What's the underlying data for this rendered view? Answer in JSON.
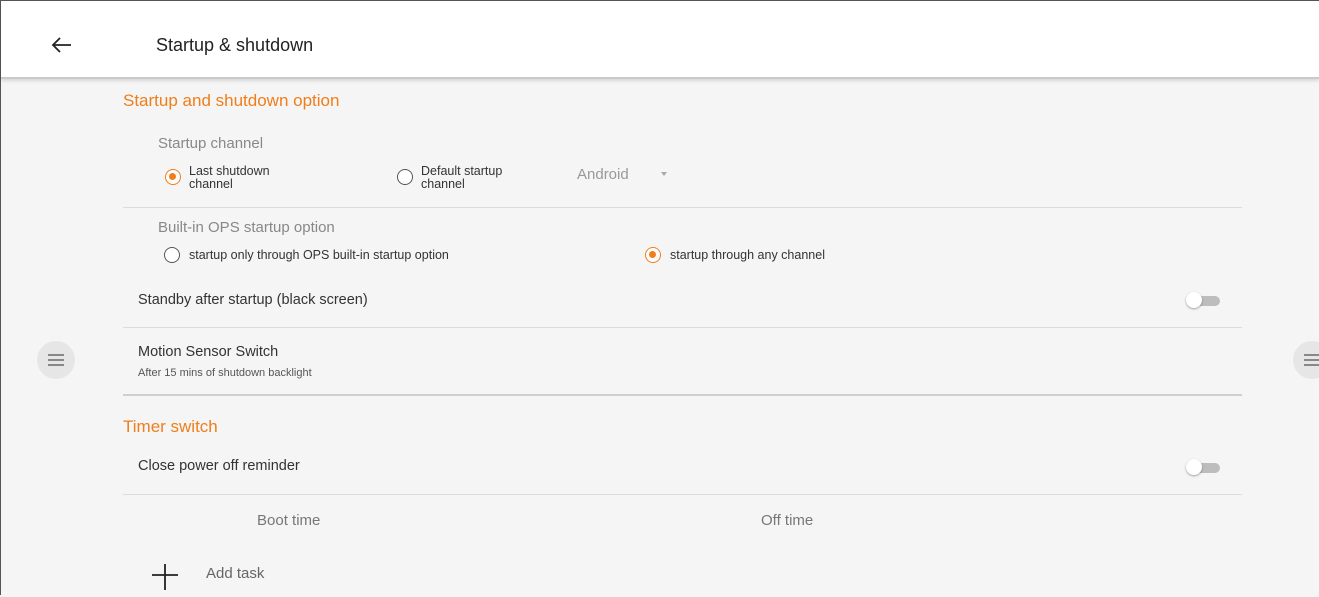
{
  "header": {
    "back_icon": "arrow-left-icon",
    "title": "Startup & shutdown"
  },
  "startup_section": {
    "title": "Startup and shutdown option",
    "startup_channel": {
      "label": "Startup channel",
      "options": [
        {
          "line1": "Last shutdown",
          "line2": "channel",
          "checked": true
        },
        {
          "line1": "Default startup",
          "line2": "channel",
          "checked": false
        }
      ],
      "dropdown_value": "Android"
    },
    "ops_option": {
      "label": "Built-in OPS startup option",
      "options": [
        {
          "label": "startup only through OPS built-in startup option",
          "checked": false
        },
        {
          "label": "startup through any channel",
          "checked": true
        }
      ]
    },
    "standby": {
      "label": "Standby after startup (black screen)",
      "enabled": false
    },
    "motion_sensor": {
      "label": "Motion Sensor Switch",
      "sublabel": "After 15 mins of shutdown backlight"
    }
  },
  "timer_section": {
    "title": "Timer switch",
    "power_off_reminder": {
      "label": "Close power off reminder",
      "enabled": false
    },
    "columns": [
      "Boot time",
      "Off time"
    ],
    "add_task_label": "Add task",
    "add_icon": "plus-icon"
  },
  "colors": {
    "accent": "#ef7e1b",
    "background": "#f5f5f5",
    "header_bg": "#ffffff"
  }
}
